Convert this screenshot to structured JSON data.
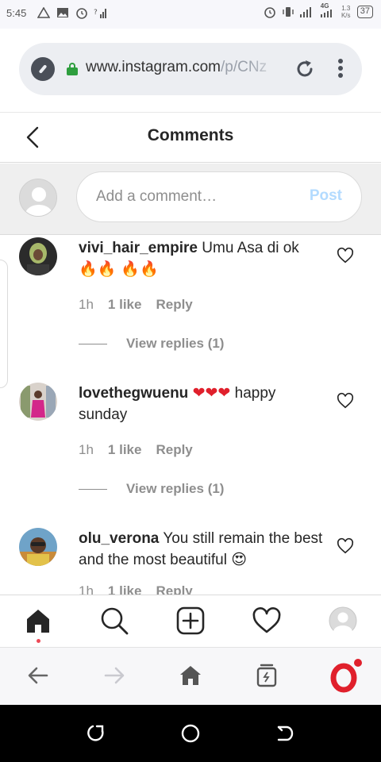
{
  "status_bar": {
    "time": "5:45",
    "network_label": "4G",
    "speed_value": "1.3",
    "speed_unit": "K/s",
    "battery": "37"
  },
  "browser": {
    "url_host": "www.instagram.com",
    "url_path": "/p/CNz",
    "lock_color": "#2e9e3e"
  },
  "header": {
    "title": "Comments"
  },
  "compose": {
    "placeholder": "Add a comment…",
    "post_label": "Post",
    "post_color": "#b3dbff"
  },
  "comments": [
    {
      "username": "vivi_hair_empire",
      "text": "Umu Asa di ok",
      "emoji": "🔥🔥 🔥🔥",
      "time": "1h",
      "likes": "1 like",
      "reply_label": "Reply",
      "view_replies": "View replies (1)"
    },
    {
      "username": "lovethegwuenu",
      "emoji": "❤❤❤",
      "text": "happy sunday",
      "time": "1h",
      "likes": "1 like",
      "reply_label": "Reply",
      "view_replies": "View replies (1)"
    },
    {
      "username": "olu_verona",
      "text": "You still remain the best and the most beautiful",
      "emoji": "😍",
      "time": "1h",
      "likes": "1 like",
      "reply_label": "Reply"
    }
  ],
  "ig_nav": {
    "items": [
      "home-icon",
      "search-icon",
      "new-post-icon",
      "activity-heart-icon",
      "profile-avatar"
    ]
  },
  "browser_nav": {
    "items": [
      "back-arrow-icon",
      "forward-arrow-icon",
      "home-icon",
      "tabs-icon",
      "opera-logo"
    ],
    "opera_red": "#e0202c"
  }
}
